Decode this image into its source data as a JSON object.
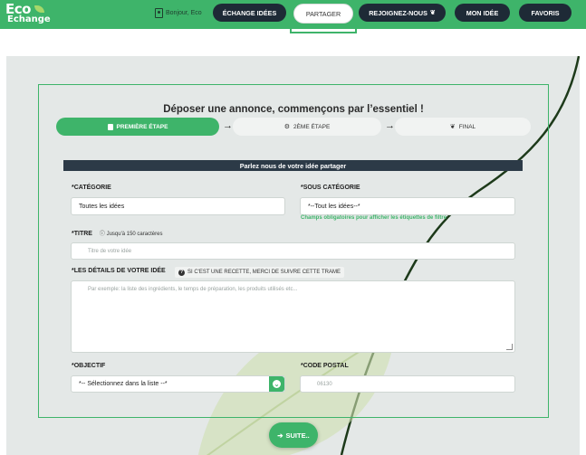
{
  "brand": {
    "line1": "Eco",
    "line2": "Echange"
  },
  "header": {
    "greeting": "Bonjour, Eco",
    "nav": [
      {
        "label": "ÉCHANGE IDÉES"
      },
      {
        "label": "PARTAGER"
      },
      {
        "label": "REJOIGNEZ-NOUS"
      },
      {
        "label": "MON IDÉE"
      },
      {
        "label": "FAVORIS"
      }
    ],
    "active": "PARTAGER"
  },
  "form": {
    "title": "Déposer une annonce, commençons par l’essentiel !",
    "steps": [
      {
        "label": "PREMIÈRE ÉTAPE",
        "icon": "clipboard-icon"
      },
      {
        "label": "2ÈME ÉTAPE",
        "icon": "gear-icon"
      },
      {
        "label": "FINAL",
        "icon": "sprout-icon"
      }
    ],
    "section_title": "Parlez nous de votre idée partager",
    "category": {
      "label": "*CATÉGORIE",
      "value": "Toutes les idées"
    },
    "subcategory": {
      "label": "*SOUS CATÉGORIE",
      "value": "*--Tout les idées--*",
      "note": "Champs obligatoires pour afficher les étiquettes de filtre"
    },
    "title_field": {
      "label": "*TITRE",
      "hint": "Jusqu'à 150 caractères",
      "placeholder": "Titre de votre idée"
    },
    "details": {
      "label": "*LES DÉTAILS DE VOTRE IDÉE",
      "badge": "SI C'EST UNE RECETTE, MERCI DE SUIVRE CETTE TRAME",
      "placeholder": "Par exemple: la liste des ingrédients, le temps de préparation, les produits utilisés etc..."
    },
    "objective": {
      "label": "*OBJECTIF",
      "value": "*-- Sélectionnez dans la liste --*"
    },
    "postal": {
      "label": "*CODE POSTAL",
      "placeholder": "06130"
    },
    "next_button": "SUITE.."
  },
  "colors": {
    "accent": "#3eb46a",
    "dark": "#1e2a36",
    "panel": "#e4e8e7"
  }
}
